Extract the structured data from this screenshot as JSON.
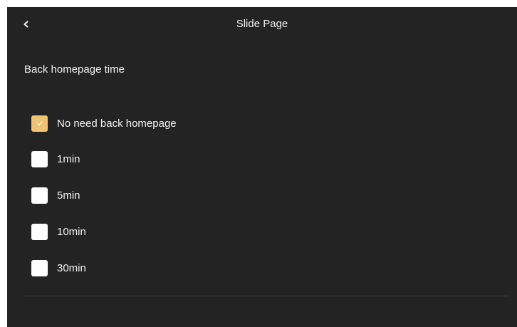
{
  "header": {
    "back_icon": "chevron-left-icon",
    "title": "Slide Page"
  },
  "section": {
    "title": "Back homepage time"
  },
  "options": [
    {
      "label": "No need back homepage",
      "checked": true
    },
    {
      "label": "1min",
      "checked": false
    },
    {
      "label": "5min",
      "checked": false
    },
    {
      "label": "10min",
      "checked": false
    },
    {
      "label": "30min",
      "checked": false
    }
  ],
  "colors": {
    "background": "#232323",
    "checked_accent": "#eec374",
    "unchecked_box": "#ffffff",
    "text": "#f2f2f2"
  }
}
